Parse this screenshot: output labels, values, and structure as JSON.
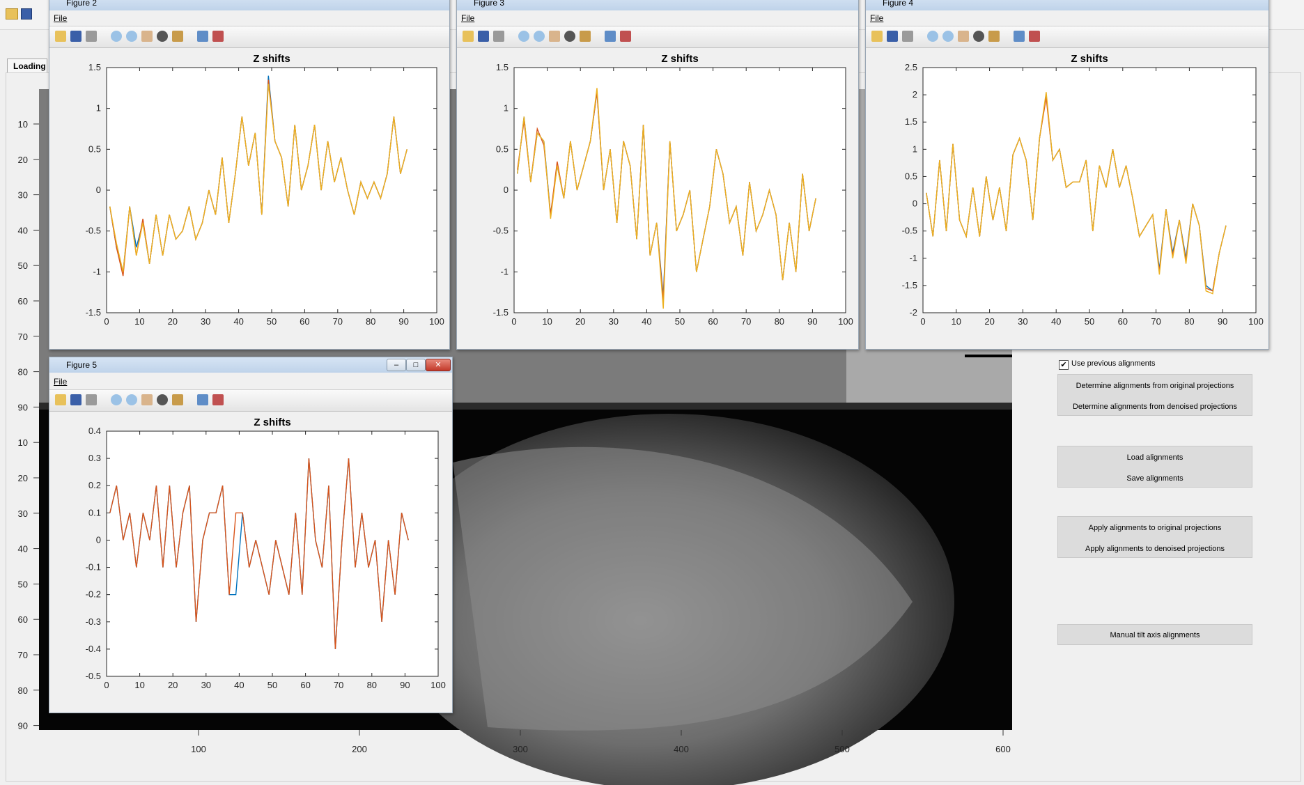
{
  "app": {
    "tab_label": "Loading",
    "y_ticks": [
      "10",
      "20",
      "30",
      "40",
      "50",
      "60",
      "70",
      "80",
      "90",
      "10",
      "20",
      "30",
      "40",
      "50",
      "60",
      "70",
      "80",
      "90"
    ],
    "x_ticks": [
      "100",
      "200",
      "300",
      "400",
      "500",
      "600"
    ]
  },
  "controls": {
    "checkbox_label": "Use previous alignments",
    "checkbox_checked": true,
    "buttons": [
      "Determine alignments from original projections",
      "Determine alignments from denoised projections",
      "Load alignments",
      "Save alignments",
      "Apply alignments to original projections",
      "Apply alignments to denoised projections",
      "Manual tilt axis alignments"
    ]
  },
  "windows": {
    "fig2_title": "Figure 2",
    "fig3_title": "Figure 3",
    "fig4_title": "Figure 4",
    "fig5_title": "Figure 5",
    "menu_file": "File"
  },
  "chart_data": [
    {
      "type": "line",
      "title": "Z shifts",
      "xlim": [
        0,
        100
      ],
      "ylim": [
        -1.5,
        1.5
      ],
      "xticks": [
        0,
        10,
        20,
        30,
        40,
        50,
        60,
        70,
        80,
        90,
        100
      ],
      "yticks": [
        -1.5,
        -1,
        -0.5,
        0,
        0.5,
        1,
        1.5
      ],
      "colors": [
        "#0072bd",
        "#d95319",
        "#edb120"
      ],
      "x": [
        1,
        3,
        5,
        7,
        9,
        11,
        13,
        15,
        17,
        19,
        21,
        23,
        25,
        27,
        29,
        31,
        33,
        35,
        37,
        39,
        41,
        43,
        45,
        47,
        49,
        51,
        53,
        55,
        57,
        59,
        61,
        63,
        65,
        67,
        69,
        71,
        73,
        75,
        77,
        79,
        81,
        83,
        85,
        87,
        89,
        91
      ],
      "series": [
        {
          "values": [
            -0.2,
            -0.7,
            -1.0,
            -0.2,
            -0.7,
            -0.4,
            -0.9,
            -0.3,
            -0.8,
            -0.3,
            -0.6,
            -0.5,
            -0.2,
            -0.6,
            -0.4,
            0.0,
            -0.3,
            0.4,
            -0.4,
            0.2,
            0.9,
            0.3,
            0.7,
            -0.3,
            1.4,
            0.6,
            0.4,
            -0.2,
            0.8,
            0.0,
            0.3,
            0.8,
            0.0,
            0.6,
            0.1,
            0.4,
            0.0,
            -0.3,
            0.1,
            -0.1,
            0.1,
            -0.1,
            0.2,
            0.9,
            0.2,
            0.5
          ]
        },
        {
          "values": [
            -0.2,
            -0.7,
            -1.05,
            -0.2,
            -0.8,
            -0.35,
            -0.9,
            -0.3,
            -0.8,
            -0.3,
            -0.6,
            -0.5,
            -0.2,
            -0.6,
            -0.4,
            0.0,
            -0.3,
            0.4,
            -0.4,
            0.2,
            0.9,
            0.3,
            0.7,
            -0.3,
            1.35,
            0.6,
            0.4,
            -0.2,
            0.8,
            0.0,
            0.3,
            0.8,
            0.0,
            0.6,
            0.1,
            0.4,
            0.0,
            -0.3,
            0.1,
            -0.1,
            0.1,
            -0.1,
            0.2,
            0.9,
            0.2,
            0.5
          ]
        },
        {
          "values": [
            -0.2,
            -0.65,
            -1.0,
            -0.2,
            -0.8,
            -0.4,
            -0.9,
            -0.3,
            -0.8,
            -0.3,
            -0.6,
            -0.5,
            -0.2,
            -0.6,
            -0.4,
            0.0,
            -0.3,
            0.4,
            -0.4,
            0.2,
            0.9,
            0.3,
            0.7,
            -0.3,
            1.3,
            0.6,
            0.4,
            -0.2,
            0.8,
            0.0,
            0.3,
            0.8,
            0.0,
            0.6,
            0.1,
            0.4,
            0.0,
            -0.3,
            0.1,
            -0.1,
            0.1,
            -0.1,
            0.2,
            0.9,
            0.2,
            0.5
          ]
        }
      ]
    },
    {
      "type": "line",
      "title": "Z shifts",
      "xlim": [
        0,
        100
      ],
      "ylim": [
        -1.5,
        1.5
      ],
      "xticks": [
        0,
        10,
        20,
        30,
        40,
        50,
        60,
        70,
        80,
        90,
        100
      ],
      "yticks": [
        -1.5,
        -1,
        -0.5,
        0,
        0.5,
        1,
        1.5
      ],
      "colors": [
        "#0072bd",
        "#d95319",
        "#edb120"
      ],
      "x": [
        1,
        3,
        5,
        7,
        9,
        11,
        13,
        15,
        17,
        19,
        21,
        23,
        25,
        27,
        29,
        31,
        33,
        35,
        37,
        39,
        41,
        43,
        45,
        47,
        49,
        51,
        53,
        55,
        57,
        59,
        61,
        63,
        65,
        67,
        69,
        71,
        73,
        75,
        77,
        79,
        81,
        83,
        85,
        87,
        89,
        91
      ],
      "series": [
        {
          "values": [
            0.2,
            0.9,
            0.1,
            0.7,
            0.6,
            -0.3,
            0.3,
            -0.1,
            0.6,
            0.0,
            0.3,
            0.6,
            1.2,
            0.0,
            0.5,
            -0.4,
            0.6,
            0.3,
            -0.6,
            0.8,
            -0.8,
            -0.4,
            -1.3,
            0.6,
            -0.5,
            -0.3,
            0.0,
            -1.0,
            -0.6,
            -0.2,
            0.5,
            0.2,
            -0.4,
            -0.2,
            -0.8,
            0.1,
            -0.5,
            -0.3,
            0.0,
            -0.3,
            -1.1,
            -0.4,
            -1.0,
            0.2,
            -0.5,
            -0.1
          ]
        },
        {
          "values": [
            0.25,
            0.85,
            0.1,
            0.75,
            0.55,
            -0.3,
            0.35,
            -0.1,
            0.6,
            0.0,
            0.3,
            0.6,
            1.2,
            0.0,
            0.5,
            -0.4,
            0.6,
            0.3,
            -0.6,
            0.8,
            -0.8,
            -0.4,
            -1.35,
            0.6,
            -0.5,
            -0.3,
            0.0,
            -1.0,
            -0.6,
            -0.2,
            0.5,
            0.2,
            -0.4,
            -0.2,
            -0.8,
            0.1,
            -0.5,
            -0.3,
            0.0,
            -0.3,
            -1.1,
            -0.4,
            -1.0,
            0.2,
            -0.5,
            -0.1
          ]
        },
        {
          "values": [
            0.2,
            0.9,
            0.1,
            0.7,
            0.6,
            -0.35,
            0.3,
            -0.1,
            0.6,
            0.0,
            0.3,
            0.6,
            1.25,
            0.0,
            0.5,
            -0.4,
            0.6,
            0.3,
            -0.6,
            0.8,
            -0.8,
            -0.4,
            -1.45,
            0.6,
            -0.5,
            -0.3,
            0.0,
            -1.0,
            -0.6,
            -0.2,
            0.5,
            0.2,
            -0.4,
            -0.2,
            -0.8,
            0.1,
            -0.5,
            -0.3,
            0.0,
            -0.3,
            -1.1,
            -0.4,
            -1.0,
            0.2,
            -0.5,
            -0.1
          ]
        }
      ]
    },
    {
      "type": "line",
      "title": "Z shifts",
      "xlim": [
        0,
        100
      ],
      "ylim": [
        -2,
        2.5
      ],
      "xticks": [
        0,
        10,
        20,
        30,
        40,
        50,
        60,
        70,
        80,
        90,
        100
      ],
      "yticks": [
        -2,
        -1.5,
        -1,
        -0.5,
        0,
        0.5,
        1,
        1.5,
        2,
        2.5
      ],
      "colors": [
        "#0072bd",
        "#d95319",
        "#edb120"
      ],
      "x": [
        1,
        3,
        5,
        7,
        9,
        11,
        13,
        15,
        17,
        19,
        21,
        23,
        25,
        27,
        29,
        31,
        33,
        35,
        37,
        39,
        41,
        43,
        45,
        47,
        49,
        51,
        53,
        55,
        57,
        59,
        61,
        63,
        65,
        67,
        69,
        71,
        73,
        75,
        77,
        79,
        81,
        83,
        85,
        87,
        89,
        91
      ],
      "series": [
        {
          "values": [
            0.2,
            -0.6,
            0.8,
            -0.5,
            1.1,
            -0.3,
            -0.6,
            0.3,
            -0.6,
            0.5,
            -0.3,
            0.3,
            -0.5,
            0.9,
            1.2,
            0.8,
            -0.3,
            1.2,
            2.0,
            0.8,
            1.0,
            0.3,
            0.4,
            0.4,
            0.8,
            -0.5,
            0.7,
            0.3,
            1.0,
            0.3,
            0.7,
            0.1,
            -0.6,
            -0.4,
            -0.2,
            -1.2,
            -0.1,
            -0.9,
            -0.3,
            -1.0,
            0.0,
            -0.4,
            -1.5,
            -1.6,
            -0.9,
            -0.4
          ]
        },
        {
          "values": [
            0.2,
            -0.6,
            0.8,
            -0.5,
            1.1,
            -0.3,
            -0.6,
            0.3,
            -0.6,
            0.5,
            -0.3,
            0.3,
            -0.5,
            0.9,
            1.2,
            0.8,
            -0.3,
            1.2,
            1.95,
            0.8,
            1.0,
            0.3,
            0.4,
            0.4,
            0.8,
            -0.5,
            0.7,
            0.3,
            1.0,
            0.3,
            0.7,
            0.1,
            -0.6,
            -0.4,
            -0.2,
            -1.25,
            -0.1,
            -0.95,
            -0.3,
            -1.05,
            0.0,
            -0.4,
            -1.55,
            -1.6,
            -0.9,
            -0.4
          ]
        },
        {
          "values": [
            0.2,
            -0.6,
            0.8,
            -0.5,
            1.1,
            -0.3,
            -0.6,
            0.3,
            -0.6,
            0.5,
            -0.3,
            0.3,
            -0.5,
            0.9,
            1.2,
            0.8,
            -0.3,
            1.2,
            2.05,
            0.8,
            1.0,
            0.3,
            0.4,
            0.4,
            0.8,
            -0.5,
            0.7,
            0.3,
            1.0,
            0.3,
            0.7,
            0.1,
            -0.6,
            -0.4,
            -0.2,
            -1.3,
            -0.1,
            -1.0,
            -0.3,
            -1.1,
            0.0,
            -0.4,
            -1.6,
            -1.65,
            -0.9,
            -0.4
          ]
        }
      ]
    },
    {
      "type": "line",
      "title": "Z shifts",
      "xlim": [
        0,
        100
      ],
      "ylim": [
        -0.5,
        0.4
      ],
      "xticks": [
        0,
        10,
        20,
        30,
        40,
        50,
        60,
        70,
        80,
        90,
        100
      ],
      "yticks": [
        -0.5,
        -0.4,
        -0.3,
        -0.2,
        -0.1,
        0,
        0.1,
        0.2,
        0.3,
        0.4
      ],
      "colors": [
        "#0072bd",
        "#d95319"
      ],
      "x": [
        1,
        3,
        5,
        7,
        9,
        11,
        13,
        15,
        17,
        19,
        21,
        23,
        25,
        27,
        29,
        31,
        33,
        35,
        37,
        39,
        41,
        43,
        45,
        47,
        49,
        51,
        53,
        55,
        57,
        59,
        61,
        63,
        65,
        67,
        69,
        71,
        73,
        75,
        77,
        79,
        81,
        83,
        85,
        87,
        89,
        91
      ],
      "series": [
        {
          "values": [
            0.1,
            0.2,
            0.0,
            0.1,
            -0.1,
            0.1,
            0.0,
            0.2,
            -0.1,
            0.2,
            -0.1,
            0.1,
            0.2,
            -0.3,
            0.0,
            0.1,
            0.1,
            0.2,
            -0.2,
            -0.2,
            0.1,
            -0.1,
            0.0,
            -0.1,
            -0.2,
            0.0,
            -0.1,
            -0.2,
            0.1,
            -0.2,
            0.3,
            0.0,
            -0.1,
            0.2,
            -0.4,
            0.0,
            0.3,
            -0.1,
            0.1,
            -0.1,
            0.0,
            -0.3,
            0.0,
            -0.2,
            0.1,
            0.0
          ]
        },
        {
          "values": [
            0.1,
            0.2,
            0.0,
            0.1,
            -0.1,
            0.1,
            0.0,
            0.2,
            -0.1,
            0.2,
            -0.1,
            0.1,
            0.2,
            -0.3,
            0.0,
            0.1,
            0.1,
            0.2,
            -0.2,
            0.1,
            0.1,
            -0.1,
            0.0,
            -0.1,
            -0.2,
            0.0,
            -0.1,
            -0.2,
            0.1,
            -0.2,
            0.3,
            0.0,
            -0.1,
            0.2,
            -0.4,
            0.0,
            0.3,
            -0.1,
            0.1,
            -0.1,
            0.0,
            -0.3,
            0.0,
            -0.2,
            0.1,
            0.0
          ]
        }
      ]
    }
  ]
}
